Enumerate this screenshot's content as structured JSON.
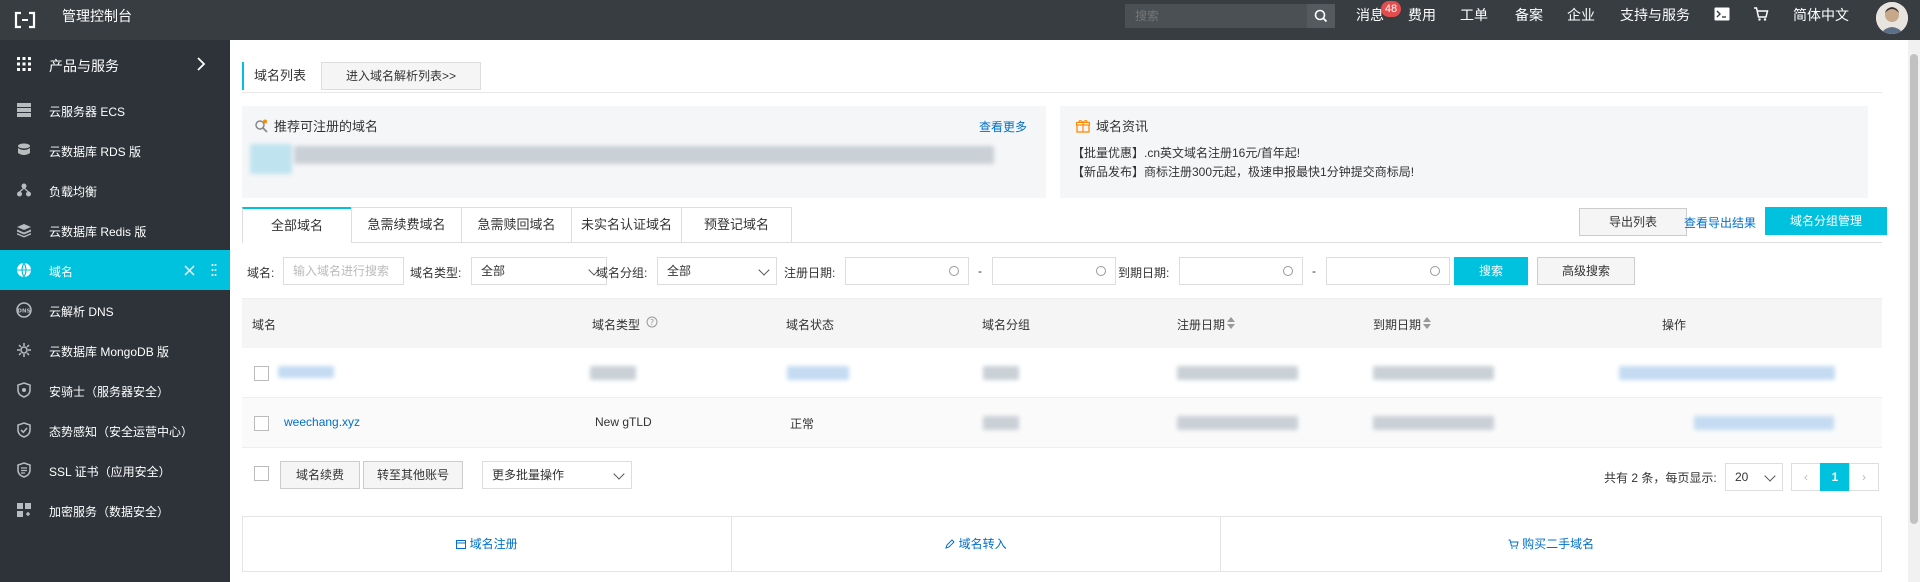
{
  "topbar": {
    "title": "管理控制台",
    "search_placeholder": "搜索",
    "nav": [
      "消息",
      "费用",
      "工单",
      "备案",
      "企业",
      "支持与服务",
      "简体中文"
    ],
    "message_badge": "48"
  },
  "sidebar": {
    "header": "产品与服务",
    "items": [
      {
        "label": "云服务器 ECS",
        "icon": "server-icon"
      },
      {
        "label": "云数据库 RDS 版",
        "icon": "database-icon"
      },
      {
        "label": "负载均衡",
        "icon": "load-balancer-icon"
      },
      {
        "label": "云数据库 Redis 版",
        "icon": "redis-icon"
      },
      {
        "label": "域名",
        "icon": "globe-icon",
        "active": true
      },
      {
        "label": "云解析 DNS",
        "icon": "dns-icon"
      },
      {
        "label": "云数据库 MongoDB 版",
        "icon": "mongodb-icon"
      },
      {
        "label": "安骑士（服务器安全）",
        "icon": "shield-icon"
      },
      {
        "label": "态势感知（安全运营中心）",
        "icon": "shield-check-icon"
      },
      {
        "label": "SSL 证书（应用安全）",
        "icon": "certificate-icon"
      },
      {
        "label": "加密服务（数据安全）",
        "icon": "encryption-icon"
      }
    ]
  },
  "breadcrumb": {
    "title": "域名列表",
    "button": "进入域名解析列表>>"
  },
  "recommend": {
    "title": "推荐可注册的域名",
    "more": "查看更多"
  },
  "news": {
    "title": "域名资讯",
    "lines": [
      "【批量优惠】.cn英文域名注册16元/首年起!",
      "【新品发布】商标注册300元起，极速申报最快1分钟提交商标局!"
    ]
  },
  "tabs": [
    "全部域名",
    "急需续费域名",
    "急需赎回域名",
    "未实名认证域名",
    "预登记域名"
  ],
  "actions": {
    "export": "导出列表",
    "view_export": "查看导出结果",
    "group_manage": "域名分组管理"
  },
  "filters": {
    "domain_label": "域名:",
    "domain_placeholder": "输入域名进行搜索",
    "type_label": "域名类型:",
    "type_value": "全部",
    "group_label": "域名分组:",
    "group_value": "全部",
    "reg_date_label": "注册日期:",
    "exp_date_label": "到期日期:",
    "dash": "-",
    "search": "搜索",
    "advanced": "高级搜索"
  },
  "table": {
    "columns": [
      "域名",
      "域名类型",
      "域名状态",
      "域名分组",
      "注册日期",
      "到期日期",
      "操作"
    ],
    "rows": [
      {
        "domain": "",
        "type": "",
        "status": "",
        "group": "",
        "reg": "",
        "exp": "",
        "ops": ""
      },
      {
        "domain": "weechang.xyz",
        "type": "New gTLD",
        "status": "正常",
        "group": "",
        "reg": "",
        "exp": "",
        "ops": ""
      }
    ]
  },
  "batch": {
    "renew": "域名续费",
    "transfer": "转至其他账号",
    "more": "更多批量操作"
  },
  "pagination": {
    "summary": "共有 2 条，每页显示:",
    "page_size": "20",
    "prev": "‹",
    "current": "1",
    "next": "›"
  },
  "bottom": {
    "register": "域名注册",
    "transfer_in": "域名转入",
    "buy_second_hand": "购买二手域名"
  },
  "colors": {
    "accent": "#00c1de",
    "topbar_bg": "#373d41",
    "sidebar_bg": "#2d3338",
    "link": "#0070cc",
    "badge": "#e34d4d"
  }
}
